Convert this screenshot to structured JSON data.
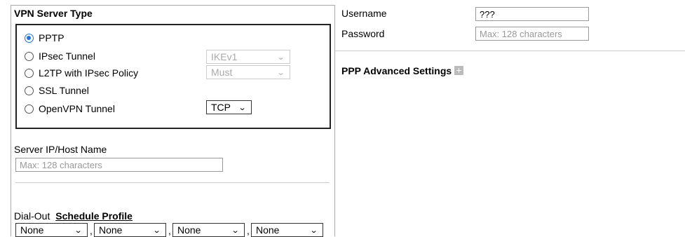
{
  "vpn_server_type": {
    "title": "VPN Server Type",
    "options": [
      {
        "label": "PPTP",
        "selected": true
      },
      {
        "label": "IPsec Tunnel",
        "selected": false,
        "select_value": "IKEv1",
        "select_enabled": false
      },
      {
        "label": "L2TP with IPsec Policy",
        "selected": false,
        "select_value": "Must",
        "select_enabled": false
      },
      {
        "label": "SSL Tunnel",
        "selected": false
      },
      {
        "label": "OpenVPN Tunnel",
        "selected": false,
        "select_value": "TCP",
        "select_enabled": true
      }
    ]
  },
  "server": {
    "label": "Server IP/Host Name",
    "placeholder": "Max: 128 characters"
  },
  "dialout": {
    "label": "Dial-Out",
    "link": "Schedule Profile",
    "schedules": [
      "None",
      "None",
      "None",
      "None"
    ]
  },
  "auth": {
    "username_label": "Username",
    "username_value": "???",
    "password_label": "Password",
    "password_placeholder": "Max: 128 characters"
  },
  "ppp": {
    "title": "PPP Advanced Settings",
    "expand_icon": "plus-icon"
  }
}
